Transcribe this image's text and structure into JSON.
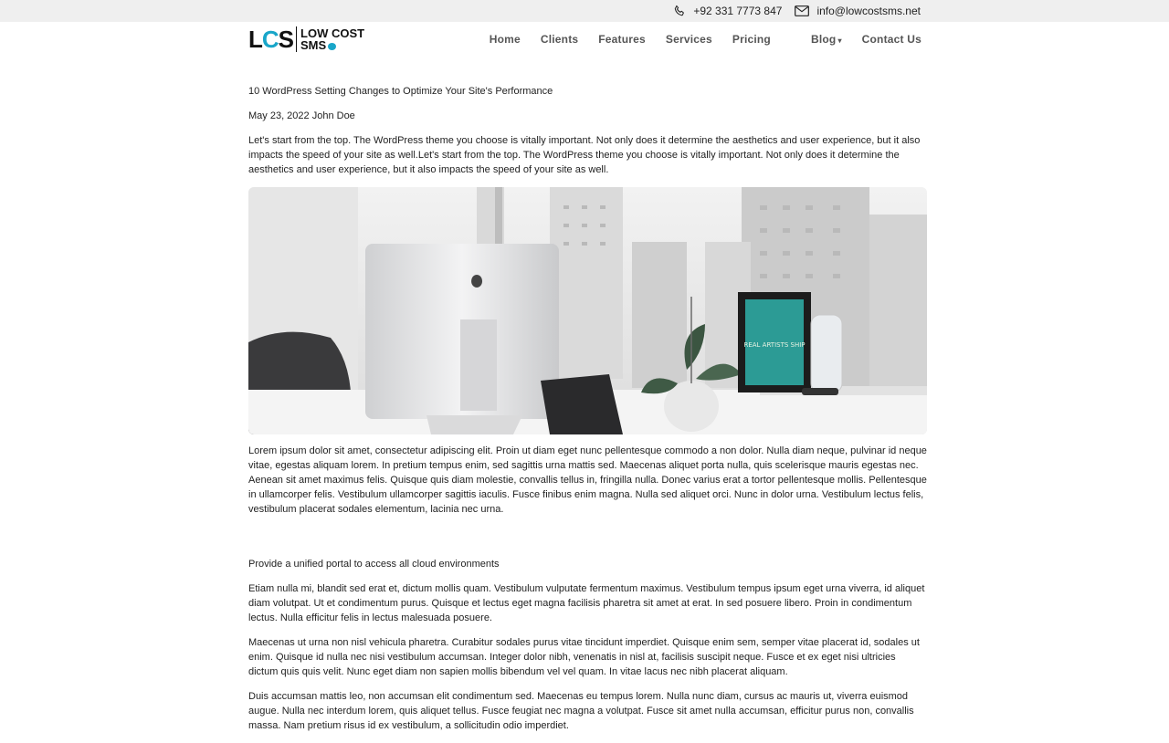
{
  "topbar": {
    "phone": "+92 331 7773 847",
    "email": "info@lowcostsms.net",
    "phone_icon": "phone-icon",
    "email_icon": "mail-icon"
  },
  "logo": {
    "mark": "LCS",
    "line1": "LOW COST",
    "line2": "SMS"
  },
  "nav": {
    "items": [
      "Home",
      "Clients",
      "Features",
      "Services",
      "Pricing",
      "Blog",
      "Contact Us"
    ]
  },
  "article": {
    "title": "10 WordPress Setting Changes to Optimize Your Site's Performance",
    "meta": "May 23, 2022 John Doe",
    "intro": "Let's start from the top. The WordPress theme you choose is vitally important. Not only does it determine the aesthetics and user experience, but it also impacts the speed of your site as well.Let's start from the top. The WordPress theme you choose is vitally important. Not only does it determine the aesthetics and user experience, but it also impacts the speed of your site as well.",
    "para1": "Lorem ipsum dolor sit amet, consectetur adipiscing elit. Proin ut diam eget nunc pellentesque commodo a non dolor. Nulla diam neque, pulvinar id neque vitae, egestas aliquam lorem. In pretium tempus enim, sed sagittis urna mattis sed. Maecenas aliquet porta nulla, quis scelerisque mauris egestas nec. Aenean sit amet maximus felis. Quisque quis diam molestie, convallis tellus in, fringilla nulla. Donec varius erat a tortor pellentesque mollis. Pellentesque in ullamcorper felis. Vestibulum ullamcorper sagittis iaculis. Fusce finibus enim magna. Nulla sed aliquet orci. Nunc in dolor urna. Vestibulum lectus felis, vestibulum placerat sodales elementum, lacinia nec urna.",
    "subheading": "Provide a unified portal to access all cloud environments",
    "para2": "Etiam nulla mi, blandit sed erat et, dictum mollis quam. Vestibulum vulputate fermentum maximus. Vestibulum tempus ipsum eget urna viverra, id aliquet diam volutpat. Ut et condimentum purus. Quisque et lectus eget magna facilisis pharetra sit amet at erat. In sed posuere libero. Proin in condimentum lectus. Nulla efficitur felis in lectus malesuada posuere.",
    "para3": "Maecenas ut urna non nisl vehicula pharetra. Curabitur sodales purus vitae tincidunt imperdiet. Quisque enim sem, semper vitae placerat id, sodales ut enim. Quisque id nulla nec nisi vestibulum accumsan. Integer dolor nibh, venenatis in nisl at, facilisis suscipit neque. Fusce et ex eget nisi ultricies dictum quis quis velit. Nunc eget diam non sapien mollis bibendum vel vel quam. In vitae lacus nec nibh placerat aliquam.",
    "para4": "Duis accumsan mattis leo, non accumsan elit condimentum sed. Maecenas eu tempus lorem. Nulla nunc diam, cursus ac mauris ut, viverra euismod augue. Nulla nec interdum lorem, quis aliquet tellus. Fusce feugiat nec magna a volutpat. Fusce sit amet nulla accumsan, efficitur purus non, convallis massa. Nam pretium risus id ex vestibulum, a sollicitudin odio imperdiet.",
    "poster_text": "REAL ARTISTS SHIP"
  }
}
